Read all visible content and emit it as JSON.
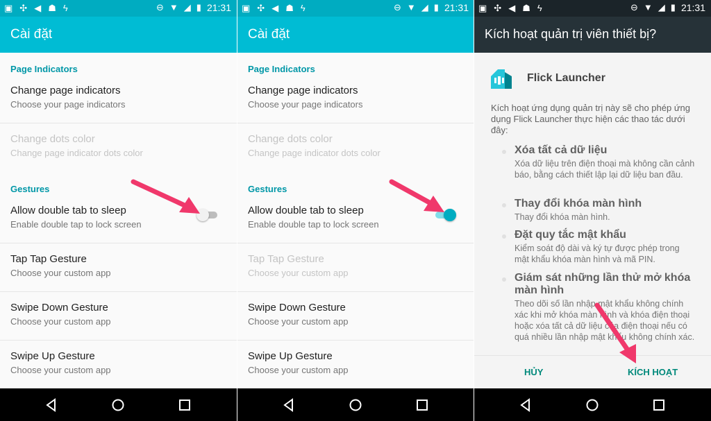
{
  "status_bar": {
    "time": "21:31",
    "left_icons": [
      "image-icon",
      "pinwheel-icon",
      "volume-icon",
      "android-icon",
      "flash-icon"
    ],
    "right_icons": [
      "dnd-icon",
      "wifi-icon",
      "signal-icon",
      "battery-icon"
    ]
  },
  "settings": {
    "title": "Cài đặt",
    "categories": {
      "page_indicators": "Page Indicators",
      "gestures": "Gestures"
    },
    "items": {
      "change_page_indicators": {
        "title": "Change page indicators",
        "summary": "Choose your page indicators"
      },
      "change_dots_color": {
        "title": "Change dots color",
        "summary": "Change page indicator dots color"
      },
      "double_tap": {
        "title": "Allow double tab to sleep",
        "summary": "Enable double tap to lock screen"
      },
      "tap_tap": {
        "title": "Tap Tap Gesture",
        "summary": "Choose your custom app"
      },
      "swipe_down": {
        "title": "Swipe Down Gesture",
        "summary": "Choose your custom app"
      },
      "swipe_up": {
        "title": "Swipe Up Gesture",
        "summary": "Choose your custom app"
      }
    },
    "panel1_switch_on": false,
    "panel2_switch_on": true
  },
  "dialog": {
    "title": "Kích hoạt quản trị viên thiết bị?",
    "app_name": "Flick Launcher",
    "intro": "Kích hoạt ứng dụng quản trị này sẽ cho phép ứng dụng Flick Launcher thực hiện các thao tác dưới đây:",
    "permissions": [
      {
        "title": "Xóa tất cả dữ liệu",
        "desc": "Xóa dữ liệu trên điện thoại mà không cần cảnh báo, bằng cách thiết lập lại dữ liệu ban đầu."
      },
      {
        "title": "Thay đổi khóa màn hình",
        "desc": "Thay đổi khóa màn hình."
      },
      {
        "title": "Đặt quy tắc mật khẩu",
        "desc": "Kiểm soát độ dài và ký tự được phép trong mật khẩu khóa màn hình và mã PIN."
      },
      {
        "title": "Giám sát những lần thử mở khóa màn hình",
        "desc": "Theo dõi số lần nhập mật khẩu không chính xác khi mở khóa màn hình và khóa điện thoại hoặc xóa tất cả dữ liệu của điện thoại nếu có quá nhiều lần nhập mật khẩu không chính xác."
      }
    ],
    "cancel_label": "HỦY",
    "activate_label": "KÍCH HOẠT"
  },
  "colors": {
    "accent": "#00bcd4",
    "status_bar": "#00acc1",
    "category_text": "#0097a7",
    "dialog_header": "#263238",
    "annotation_arrow": "#f0386b",
    "dialog_button": "#00897b"
  },
  "nav_icons": [
    "back-icon",
    "home-icon",
    "recents-icon"
  ]
}
